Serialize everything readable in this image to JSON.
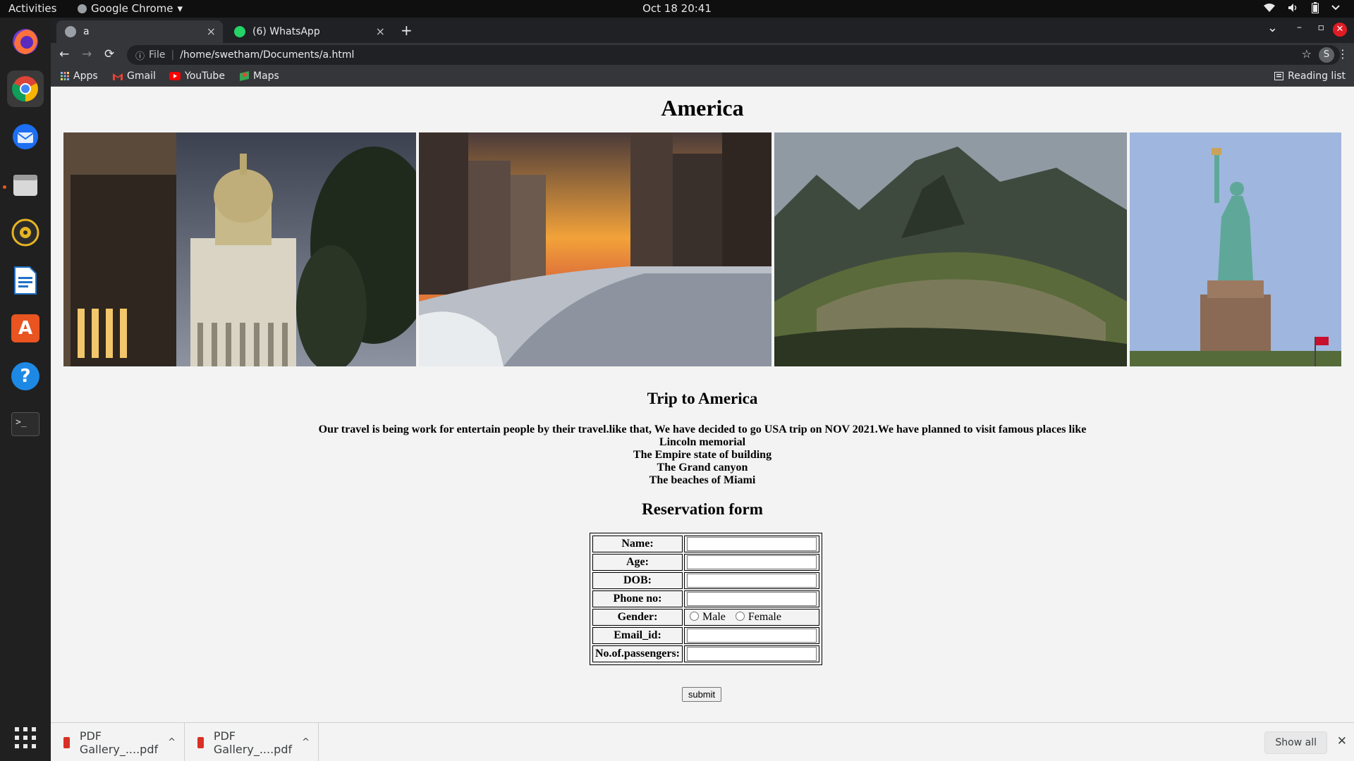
{
  "topbar": {
    "activities": "Activities",
    "app_name": "Google Chrome",
    "app_menu_arrow": "▾",
    "datetime": "Oct 18  20:41"
  },
  "dock": {
    "apps": [
      "firefox-icon",
      "chrome-icon",
      "thunderbird-icon",
      "files-icon",
      "rhythmbox-icon",
      "writer-icon",
      "software-icon",
      "help-icon",
      "terminal-icon"
    ],
    "help_glyph": "?",
    "terminal_glyph": ">_",
    "software_glyph": "A"
  },
  "browser": {
    "tabs": [
      {
        "title": "a",
        "close": "×"
      },
      {
        "title": "(6) WhatsApp",
        "close": "×"
      }
    ],
    "new_tab": "+",
    "tab_list": "⌄",
    "minimize": "–",
    "restore": "▫",
    "close": "✕",
    "url_scheme": "File",
    "url_separator": "|",
    "url": "/home/swetham/Documents/a.html",
    "info_icon": "ⓘ",
    "back": "←",
    "forward": "→",
    "reload": "⟳",
    "star": "☆",
    "profile_initial": "S",
    "menu": "⋮",
    "bookmarks": [
      {
        "label": "Apps",
        "icon": "apps-grid-icon"
      },
      {
        "label": "Gmail",
        "icon": "gmail-icon"
      },
      {
        "label": "YouTube",
        "icon": "youtube-icon"
      },
      {
        "label": "Maps",
        "icon": "maps-icon"
      }
    ],
    "reading_list": "Reading list"
  },
  "page": {
    "heading": "America",
    "photos": [
      "capitol-building-photo",
      "frozen-river-city-photo",
      "machu-picchu-photo",
      "statue-of-liberty-photo"
    ],
    "trip_heading": "Trip to America",
    "intro": "Our travel is being work for entertain people by their travel.like that, We have decided to go USA trip on NOV 2021.We have planned to visit famous places like",
    "places": [
      "Lincoln memorial",
      "The Empire state of building",
      "The Grand canyon",
      "The beaches of Miami"
    ],
    "form_heading": "Reservation form",
    "form": {
      "name_label": "Name:",
      "age_label": "Age:",
      "dob_label": "DOB:",
      "phone_label": "Phone no:",
      "gender_label": "Gender:",
      "gender_male": "Male",
      "gender_female": "Female",
      "email_label": "Email_id:",
      "passengers_label": "No.of.passengers:",
      "submit": "submit"
    }
  },
  "downloads": {
    "items": [
      {
        "filename": "PDF Gallery_....pdf",
        "arrow": "^"
      },
      {
        "filename": "PDF Gallery_....pdf",
        "arrow": "^"
      }
    ],
    "show_all": "Show all",
    "close": "✕"
  }
}
